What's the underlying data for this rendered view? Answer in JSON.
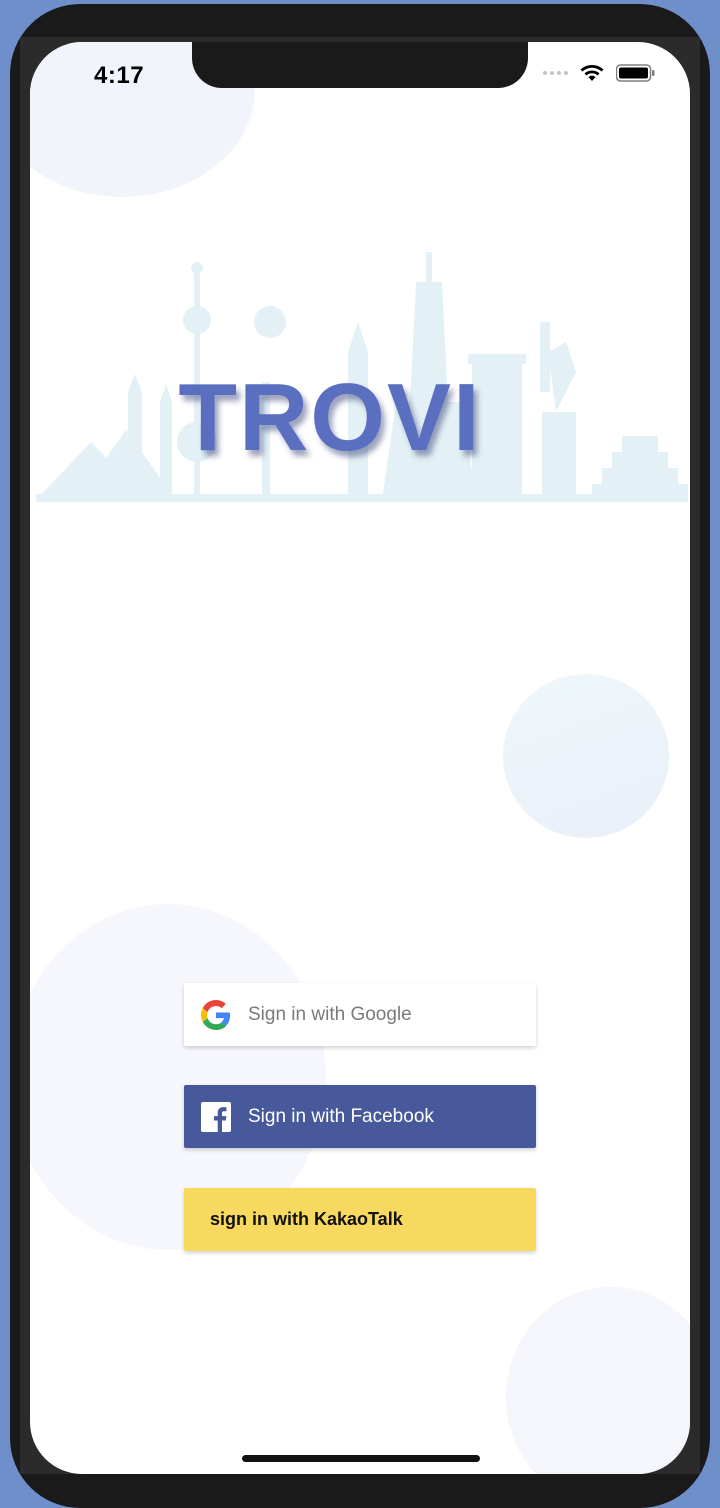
{
  "status_bar": {
    "time": "4:17"
  },
  "logo": {
    "text": "TROVI"
  },
  "buttons": {
    "google": {
      "label": "Sign in with Google",
      "icon": "google-icon"
    },
    "facebook": {
      "label": "Sign in with Facebook",
      "icon": "facebook-icon"
    },
    "kakao": {
      "label": "sign in with KakaoTalk"
    }
  },
  "colors": {
    "facebook": "#47599a",
    "kakao": "#f8d960",
    "logo": "#5b6fc0",
    "background": "#6f8fcb"
  }
}
